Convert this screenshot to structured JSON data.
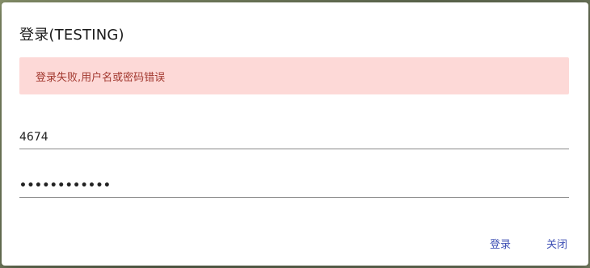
{
  "dialog": {
    "title": "登录(TESTING)",
    "error_message": "登录失败,用户名或密码错误",
    "username_value": "4674",
    "password_value": "••••••••••••",
    "login_label": "登录",
    "close_label": "关闭"
  },
  "colors": {
    "alert_bg": "#fdd9d7",
    "alert_text": "#a2382f",
    "button_text": "#3f51b5"
  }
}
